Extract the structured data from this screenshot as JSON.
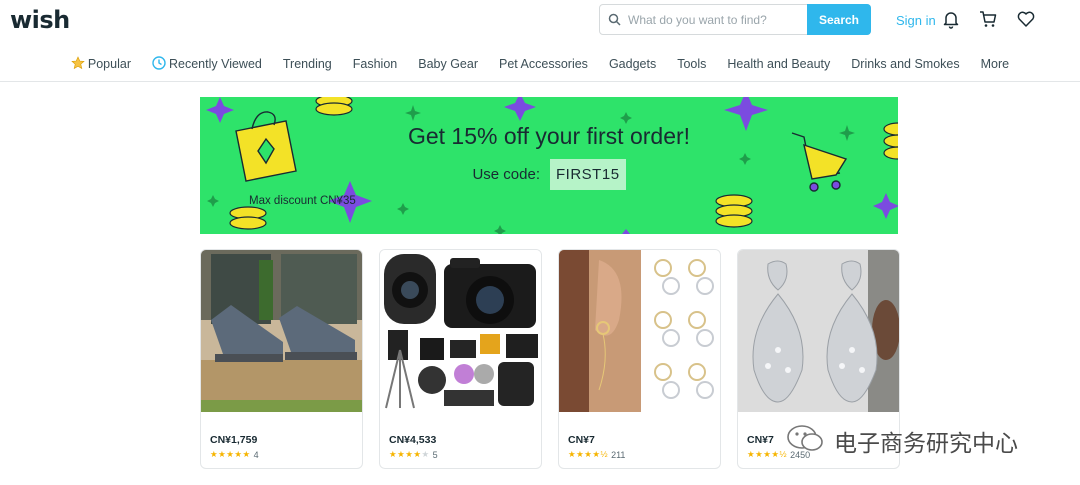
{
  "header": {
    "logo": "wish",
    "search_placeholder": "What do you want to find?",
    "search_button": "Search",
    "sign_in": "Sign in",
    "icons": [
      "bell-icon",
      "cart-icon",
      "heart-icon"
    ]
  },
  "nav": [
    {
      "label": "Popular",
      "icon": "star-icon"
    },
    {
      "label": "Recently Viewed",
      "icon": "clock-icon"
    },
    {
      "label": "Trending"
    },
    {
      "label": "Fashion"
    },
    {
      "label": "Baby Gear"
    },
    {
      "label": "Pet Accessories"
    },
    {
      "label": "Gadgets"
    },
    {
      "label": "Tools"
    },
    {
      "label": "Health and Beauty"
    },
    {
      "label": "Drinks and Smokes"
    },
    {
      "label": "More"
    }
  ],
  "banner": {
    "title": "Get 15% off your first order!",
    "code_label": "Use code:",
    "code": "FIRST15",
    "max_discount": "Max discount CN¥35",
    "bg_color": "#2ee36a"
  },
  "products": [
    {
      "price": "CN¥1,759",
      "rating": 5,
      "reviews": "4",
      "image": "patio lounge chairs"
    },
    {
      "price": "CN¥4,533",
      "rating": 4,
      "reviews": "5",
      "image": "canon camera bundle"
    },
    {
      "price": "CN¥7",
      "rating": 4.5,
      "reviews": "211",
      "image": "chain earrings"
    },
    {
      "price": "CN¥7",
      "rating": 4.5,
      "reviews": "2450",
      "image": "crystal drop earrings"
    }
  ],
  "watermark": "电子商务研究中心",
  "colors": {
    "accent": "#2fb7ec",
    "star": "#f6b400",
    "text": "#192a32"
  }
}
